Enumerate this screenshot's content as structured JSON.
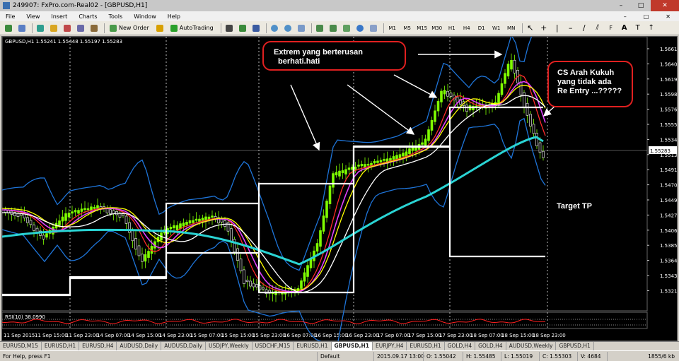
{
  "window": {
    "title": "249907: FxPro.com-Real02 - [GBPUSD,H1]",
    "controls": [
      "–",
      "□",
      "✕"
    ]
  },
  "menu": [
    "File",
    "View",
    "Insert",
    "Charts",
    "Tools",
    "Window",
    "Help"
  ],
  "doc_controls": [
    "–",
    "□",
    "✕"
  ],
  "toolbar": {
    "new_order": "New Order",
    "autotrading": "AutoTrading",
    "timeframes": [
      "M1",
      "M5",
      "M15",
      "M30",
      "H1",
      "H4",
      "D1",
      "W1",
      "MN"
    ]
  },
  "chart": {
    "header": "GBPUSD,H1  1.55241 1.55448 1.55197 1.55283",
    "price_labels": [
      "1.5661",
      "1.5640",
      "1.5619",
      "1.5598",
      "1.5576",
      "1.5555",
      "1.5534",
      "1.5513",
      "1.5491",
      "1.5470",
      "1.5449",
      "1.5427",
      "1.5406",
      "1.5385",
      "1.5364",
      "1.5343",
      "1.5321"
    ],
    "current_price": "1.55283",
    "time_labels": [
      "11 Sep 2015",
      "11 Sep 15:00",
      "11 Sep 23:00",
      "14 Sep 07:00",
      "14 Sep 15:00",
      "14 Sep 23:00",
      "15 Sep 07:00",
      "15 Sep 15:00",
      "15 Sep 23:00",
      "16 Sep 07:00",
      "16 Sep 15:00",
      "16 Sep 23:00",
      "17 Sep 07:00",
      "17 Sep 15:00",
      "17 Sep 23:00",
      "18 Sep 07:00",
      "18 Sep 15:00",
      "18 Sep 23:00"
    ],
    "rsi_label": "RSI(10) 38.0990",
    "annotation_1": [
      "Extrem  yang berterusan",
      "berhati.hati"
    ],
    "annotation_2": [
      "CS  Arah  Kukuh",
      "yang  tidak ada",
      "Re Entry  ...?????"
    ],
    "target_label": "Target  TP",
    "colors": {
      "background": "#000000",
      "bullish": "#7fff00",
      "bearish": "#ffffff",
      "ma_cyan": "#2ad4d4",
      "bollinger": "#1e74d8",
      "annotation_border": "#e02020"
    }
  },
  "tabs": [
    "EURUSD,M15",
    "EURUSD,H1",
    "EURUSD,H4",
    "AUDUSD,Daily",
    "AUDUSD,Daily",
    "USDJPY,Weekly",
    "USDCHF,M15",
    "EURUSD,H1",
    "GBPUSD,H1",
    "EURJPY,H4",
    "EURUSD,H1",
    "GOLD,H4",
    "GOLD,H4",
    "AUDUSD,Weekly",
    "GBPUSD,H1"
  ],
  "active_tab": 8,
  "status": {
    "help": "For Help, press F1",
    "profile": "Default",
    "time": "2015.09.17 13:00",
    "open": "O: 1.55042",
    "high": "H: 1.55485",
    "low": "L: 1.55019",
    "close": "C: 1.55303",
    "volume": "V: 4684",
    "traffic": "1855/6 kb"
  }
}
